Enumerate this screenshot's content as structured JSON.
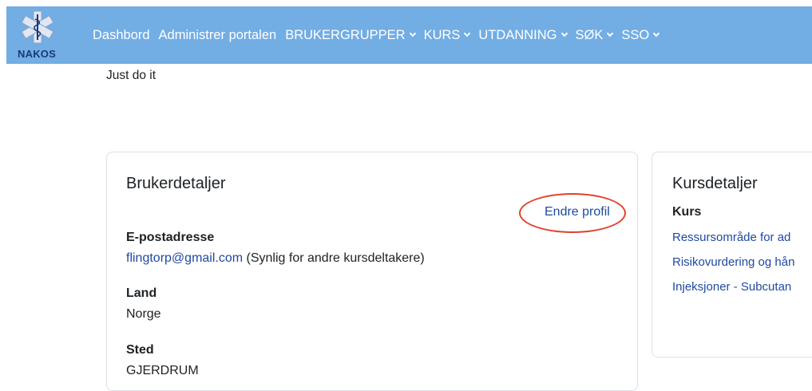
{
  "brand": {
    "logo_text": "NAKOS",
    "logo_color": "#1a3a78"
  },
  "nav": {
    "items": [
      {
        "label": "Dashbord",
        "dropdown": false
      },
      {
        "label": "Administrer portalen",
        "dropdown": false
      },
      {
        "label": "BRUKERGRUPPER",
        "dropdown": true
      },
      {
        "label": "KURS",
        "dropdown": true
      },
      {
        "label": "UTDANNING",
        "dropdown": true
      },
      {
        "label": "SØK",
        "dropdown": true
      },
      {
        "label": "SSO",
        "dropdown": true
      }
    ],
    "background": "#72ade4"
  },
  "tagline": "Just do it",
  "user_card": {
    "title": "Brukerdetaljer",
    "edit_profile": "Endre profil",
    "email": {
      "label": "E-postadresse",
      "value": "flingtorp@gmail.com",
      "note": " (Synlig for andre kursdeltakere)"
    },
    "country": {
      "label": "Land",
      "value": "Norge"
    },
    "city": {
      "label": "Sted",
      "value": "GJERDRUM"
    }
  },
  "course_card": {
    "title": "Kursdetaljer",
    "heading": "Kurs",
    "courses": [
      "Ressursområde for ad",
      "Risikovurdering og hån",
      "Injeksjoner - Subcutan"
    ]
  },
  "colors": {
    "link": "#1f4aa0",
    "highlight": "#e0422a"
  }
}
